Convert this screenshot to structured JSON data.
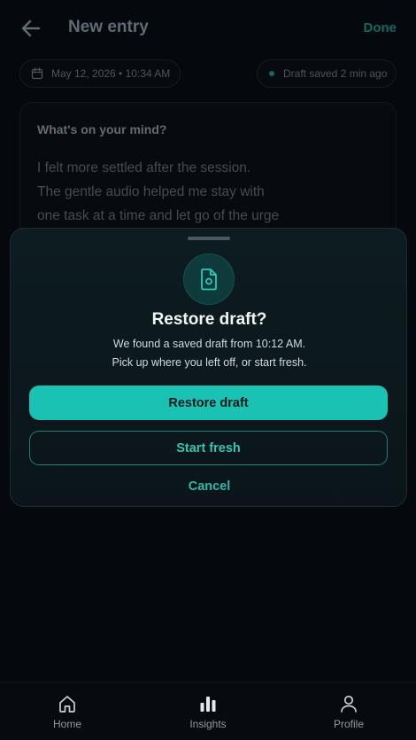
{
  "header": {
    "title": "New entry",
    "done_label": "Done"
  },
  "meta": {
    "date_time": "May 12, 2026 • 10:34 AM",
    "save_status": "Draft saved 2 min ago"
  },
  "entry": {
    "prompt": "What's on your mind?",
    "body_lines": [
      "I felt more settled after the session.",
      "The gentle audio helped me stay with",
      "one task at a time and let go of the urge"
    ]
  },
  "restore_sheet": {
    "title": "Restore draft?",
    "description_lines": [
      "We found a saved draft from 10:12 AM.",
      "Pick up where you left off, or start fresh."
    ],
    "restore_label": "Restore draft",
    "fresh_label": "Start fresh",
    "cancel_label": "Cancel"
  },
  "nav": {
    "items": [
      {
        "label": "Home",
        "icon": "home-icon"
      },
      {
        "label": "Insights",
        "icon": "bar-chart-icon"
      },
      {
        "label": "Profile",
        "icon": "user-icon"
      }
    ]
  },
  "colors": {
    "accent": "#19c2b2",
    "background": "#05080c",
    "sheet": "#0d1c21"
  }
}
